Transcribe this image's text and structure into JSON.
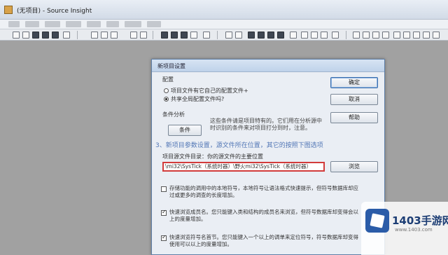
{
  "window": {
    "title": "(无项目) - Source Insight"
  },
  "dialog": {
    "title": "新项目设置",
    "config_group_label": "配置",
    "radio_project_config": "项目文件有它自己的配置文件+",
    "radio_shared_config": "共享全局配置文件吗?",
    "conditions_label": "条件分析",
    "conditions_button": "条件",
    "conditions_hint": "这些条件请是项目特有的。它们用在分析源中时识别的条件来对项目打分到时，注意。",
    "ok_button": "确定",
    "cancel_button": "取消",
    "help_button": "帮助",
    "overlay_caption": "3、新项目参数设置，源文件所在位置，其它的按照下图选项",
    "path_label": "项目源文件目录：你的源文件的主要位置",
    "path_value": "\\mi32\\SysTick（系统时器）\\野火mi32\\SysTick（系统时器）",
    "browse_button": "浏览",
    "option1": "存储功能的调用中的本地符号，本地符号让语法格式快速提示，但符号数据库却应过或更多的调查的长度增加。",
    "option2": "快速浏览成员名。您只能键入类和结构的成员名来浏览，但符号数据库却变得会以上的度量增加。",
    "option3": "快速浏览符号名首节。您只能键入一个以上的调单来定位符号，符号数据库却变得使用可以以上的度量增加。"
  },
  "watermark": {
    "brand": "1403手游网",
    "url": "www.1403.com"
  }
}
